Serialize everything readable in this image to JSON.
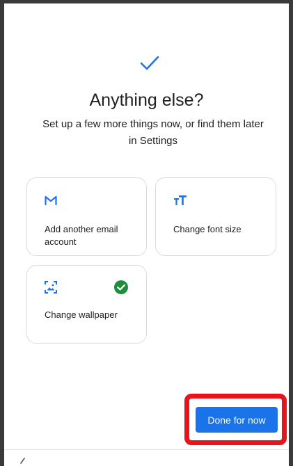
{
  "title": "Anything else?",
  "subtitle": "Set up a few more things now, or find them later in Settings",
  "cards": [
    {
      "icon": "gmail-icon",
      "label": "Add another email account",
      "completed": false
    },
    {
      "icon": "font-size-icon",
      "label": "Change font size",
      "completed": false
    },
    {
      "icon": "wallpaper-icon",
      "label": "Change wallpaper",
      "completed": true
    }
  ],
  "done_button": "Done for now",
  "colors": {
    "accent": "#1a73e8",
    "success": "#1e8e3e",
    "highlight": "#e8141c"
  }
}
